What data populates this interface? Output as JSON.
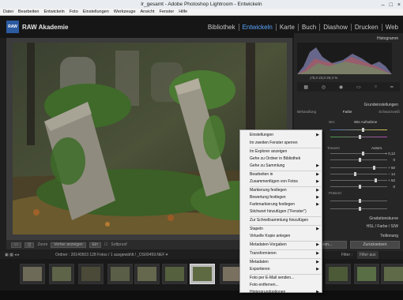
{
  "window": {
    "title": "lr_gesamt - Adobe Photoshop Lightroom - Entwickeln",
    "controls": [
      "–",
      "□",
      "×"
    ]
  },
  "menu": [
    "Datei",
    "Bearbeiten",
    "Entwickeln",
    "Foto",
    "Einstellungen",
    "Werkzeuge",
    "Ansicht",
    "Fenster",
    "Hilfe"
  ],
  "brand": {
    "logo": "RAW",
    "name": "RAW Akademie"
  },
  "modules": [
    {
      "label": "Bibliothek",
      "active": false
    },
    {
      "label": "Entwickeln",
      "active": true
    },
    {
      "label": "Karte",
      "active": false
    },
    {
      "label": "Buch",
      "active": false
    },
    {
      "label": "Diashow",
      "active": false
    },
    {
      "label": "Drucken",
      "active": false
    },
    {
      "label": "Web",
      "active": false
    }
  ],
  "right_panel": {
    "histogram_title": "Histogramm",
    "readout": "ƒ/5,0   23,0   20,4 %",
    "basic_title": "Grundeinstellungen",
    "tabs": [
      "Behandlung",
      "Farbe",
      "Schwarzweiß"
    ],
    "wb_label": "WA:",
    "wb_value": "Wie Aufnahme",
    "tone_label": "Tonwert",
    "auto_label": "Autom.",
    "values": [
      "+ 0,12",
      "0",
      "+ 50",
      "− 14",
      "+ 52",
      "0"
    ],
    "presence_label": "Präsenz",
    "tone_curve": "Gradationskurve",
    "hsl": "HSL  /  Farbe  /  S/W",
    "detail": "Teiltonung"
  },
  "sync": {
    "left": "Synchron...",
    "right": "Zurücksetzen"
  },
  "toolbar": {
    "left_btn": "Zoom",
    "mid_btn": "Vorher anzeigen",
    "right_btn": "Ein",
    "softproof": "Softproof"
  },
  "filmbar": {
    "info": "Ordner : 20140503    128 Fotos /  1 ausgewählt / _DS09459.NEF  ▾",
    "filter_label": "Filter :",
    "filter_value": "Filter aus"
  },
  "context_menu": {
    "items": [
      {
        "label": "Einstellungen",
        "sub": true
      },
      {
        "label": "Im zweiten Fenster sperren",
        "sub": false
      },
      {
        "label": "Im Explorer anzeigen",
        "sub": false
      },
      {
        "label": "Gehe zu Ordner in Bibliothek",
        "sub": false
      },
      {
        "label": "Gehe zu Sammlung",
        "sub": true
      },
      {
        "label": "Bearbeiten in",
        "sub": true
      },
      {
        "label": "Zusammenfügen von Fotos",
        "sub": true
      },
      {
        "label": "Markierung festlegen",
        "sub": true
      },
      {
        "label": "Bewertung festlegen",
        "sub": true
      },
      {
        "label": "Farbmarkierung festlegen",
        "sub": true
      },
      {
        "label": "Stichwort hinzufügen (\"Fenster\")",
        "sub": false
      },
      {
        "label": "Zur Schnellsammlung hinzufügen",
        "sub": false
      },
      {
        "label": "Stapeln",
        "sub": true
      },
      {
        "label": "Virtuelle Kopie anlegen",
        "sub": false
      },
      {
        "label": "Metadaten-Vorgaben",
        "sub": true
      },
      {
        "label": "Transformieren",
        "sub": true
      },
      {
        "label": "Metadaten",
        "sub": true
      },
      {
        "label": "Exportieren",
        "sub": true
      },
      {
        "label": "Foto per E-Mail senden...",
        "sub": false
      },
      {
        "label": "Foto entfernen...",
        "sub": false
      },
      {
        "label": "Hintergrundoptionen",
        "sub": true
      }
    ]
  },
  "colors": {
    "accent": "#5aa7ff",
    "panel": "#262626",
    "menu_bg": "#f1f1f1"
  }
}
